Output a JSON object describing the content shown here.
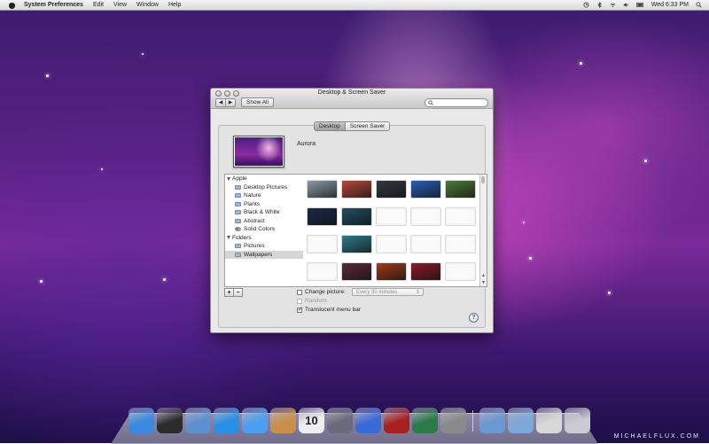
{
  "menubar": {
    "app_name": "System Preferences",
    "items": [
      "Edit",
      "View",
      "Window",
      "Help"
    ],
    "clock": "Wed 6:33 PM"
  },
  "window": {
    "title": "Desktop & Screen Saver",
    "show_all_label": "Show All",
    "search_placeholder": "",
    "tabs": [
      {
        "label": "Desktop",
        "selected": true
      },
      {
        "label": "Screen Saver",
        "selected": false
      }
    ],
    "current_picture_name": "Aurora",
    "source_list": {
      "groups": [
        {
          "label": "Apple",
          "items": [
            {
              "label": "Desktop Pictures",
              "icon": "folder-icon",
              "selected": false
            },
            {
              "label": "Nature",
              "icon": "folder-icon",
              "selected": false
            },
            {
              "label": "Plants",
              "icon": "folder-icon",
              "selected": false
            },
            {
              "label": "Black & White",
              "icon": "folder-icon",
              "selected": false
            },
            {
              "label": "Abstract",
              "icon": "folder-icon",
              "selected": false
            },
            {
              "label": "Solid Colors",
              "icon": "color-wheel-icon",
              "selected": false
            }
          ]
        },
        {
          "label": "Folders",
          "items": [
            {
              "label": "Pictures",
              "icon": "folder-icon",
              "selected": false
            },
            {
              "label": "Wallpapers",
              "icon": "folder-icon",
              "selected": true
            }
          ]
        }
      ]
    },
    "thumbnails": [
      "#8a9aa8",
      "#b34a3a",
      "#333740",
      "#2a5fb4",
      "#4d7a3a",
      "#1a2a4a",
      "#1f4f62",
      "empty",
      "empty",
      "empty",
      "empty",
      "#2e7a8a",
      "empty",
      "empty",
      "empty",
      "empty",
      "#5a2a3a",
      "#a03a1a",
      "#8a1a2a",
      "empty"
    ],
    "options": {
      "change_picture_label": "Change picture:",
      "change_picture_checked": false,
      "interval_value": "Every 30 minutes",
      "random_label": "Random",
      "random_checked": false,
      "translucent_label": "Translucent menu bar",
      "translucent_checked": true
    },
    "add_label": "+",
    "remove_label": "−",
    "help_label": "?"
  },
  "dock": {
    "apps": [
      {
        "name": "finder-icon",
        "color": "#3a8be0"
      },
      {
        "name": "dashboard-icon",
        "color": "#2c2c2c"
      },
      {
        "name": "mail-icon",
        "color": "#5e8fd0"
      },
      {
        "name": "safari-icon",
        "color": "#2a8fe6"
      },
      {
        "name": "ichat-icon",
        "color": "#4aa0ee"
      },
      {
        "name": "address-book-icon",
        "color": "#c8904a"
      },
      {
        "name": "ical-icon",
        "color": "#eeeeee",
        "date": "10"
      },
      {
        "name": "preview-icon",
        "color": "#6a6a7a"
      },
      {
        "name": "itunes-icon",
        "color": "#3a6ad8"
      },
      {
        "name": "photo-booth-icon",
        "color": "#a82020"
      },
      {
        "name": "time-machine-icon",
        "color": "#2a7a4a"
      },
      {
        "name": "system-preferences-icon",
        "color": "#8a8a8a"
      }
    ],
    "right_items": [
      {
        "name": "applications-folder-icon",
        "color": "#6a98d2"
      },
      {
        "name": "documents-folder-icon",
        "color": "#7ea6d8"
      },
      {
        "name": "downloads-stack-icon",
        "color": "#d8d8d8"
      },
      {
        "name": "trash-icon",
        "color": "#c8ccd2"
      }
    ]
  },
  "watermark": "MICHAELFLUX.COM"
}
